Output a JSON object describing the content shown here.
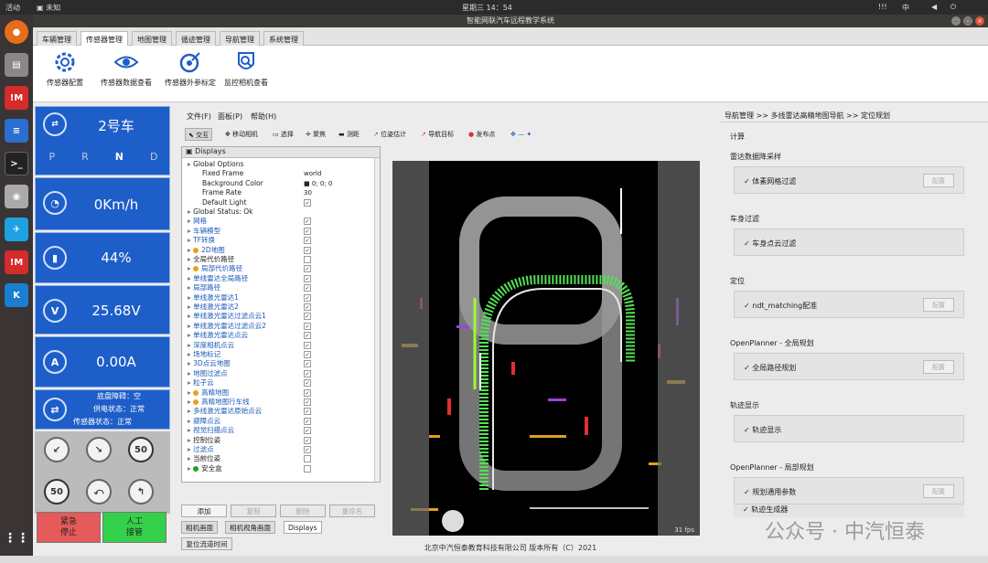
{
  "topbar": {
    "activities": "活动",
    "app": "未知",
    "clock": "星期三 14：54",
    "ime": "中",
    "net": "!!!"
  },
  "window": {
    "title": "智能网联汽车远程教学系统"
  },
  "menu_tabs": [
    "车辆管理",
    "传感器管理",
    "地图管理",
    "循迹管理",
    "导航管理",
    "系统管理"
  ],
  "ribbon": [
    {
      "label": "传感器配置",
      "icon": "gear-icon"
    },
    {
      "label": "传感器数据查看",
      "icon": "eye-icon"
    },
    {
      "label": "传感器外参标定",
      "icon": "calibrate-icon"
    },
    {
      "label": "监控相机查看",
      "icon": "camera-search-icon"
    }
  ],
  "left": {
    "car": "2号车",
    "gears": [
      "P",
      "R",
      "N",
      "D"
    ],
    "speed": "0Km/h",
    "battery": "44%",
    "voltage": "25.68V",
    "current": "0.00A",
    "circle_labels": [
      "V",
      "A"
    ],
    "status": [
      "底盘障碍：空",
      "供电状态：正常",
      "传感器状态：正常"
    ],
    "signs": [
      "50",
      "50"
    ],
    "estop": "紧急\n停止",
    "takeover": "人工\n接管"
  },
  "center": {
    "menus": [
      "文件(F)",
      "面板(P)",
      "帮助(H)"
    ],
    "tools": [
      "交互",
      "移动相机",
      "选择",
      "聚焦",
      "测距",
      "位姿估计",
      "导航目标",
      "发布点"
    ],
    "panel_title": "Displays",
    "displays": [
      {
        "label": "Global Options",
        "indent": 1,
        "value": ""
      },
      {
        "label": "Fixed Frame",
        "indent": 2,
        "value": "world"
      },
      {
        "label": "Background Color",
        "indent": 2,
        "value": "■ 0; 0; 0"
      },
      {
        "label": "Frame Rate",
        "indent": 2,
        "value": "30"
      },
      {
        "label": "Default Light",
        "indent": 2,
        "value": "✓"
      },
      {
        "label": "Global Status: Ok",
        "indent": 1,
        "value": ""
      },
      {
        "label": "网格",
        "indent": 1,
        "value": "✓",
        "blue": true
      },
      {
        "label": "车辆模型",
        "indent": 1,
        "value": "✓",
        "blue": true
      },
      {
        "label": "TF转换",
        "indent": 1,
        "value": "✓",
        "blue": true
      },
      {
        "label": "2D地图",
        "indent": 1,
        "value": "✓",
        "blue": true,
        "color": "#e8a020"
      },
      {
        "label": "全局代价路径",
        "indent": 1,
        "value": "",
        "blue": false
      },
      {
        "label": "局部代价路径",
        "indent": 1,
        "value": "✓",
        "blue": true,
        "color": "#e8a020"
      },
      {
        "label": "单线雷达全局路径",
        "indent": 1,
        "value": "✓",
        "blue": true
      },
      {
        "label": "局部路径",
        "indent": 1,
        "value": "✓",
        "blue": true
      },
      {
        "label": "单线激光雷达1",
        "indent": 1,
        "value": "✓",
        "blue": true
      },
      {
        "label": "单线激光雷达2",
        "indent": 1,
        "value": "✓",
        "blue": true
      },
      {
        "label": "单线激光雷达过滤点云1",
        "indent": 1,
        "value": "✓",
        "blue": true
      },
      {
        "label": "单线激光雷达过滤点云2",
        "indent": 1,
        "value": "✓",
        "blue": true
      },
      {
        "label": "单线激光雷达点云",
        "indent": 1,
        "value": "✓",
        "blue": true
      },
      {
        "label": "深度相机点云",
        "indent": 1,
        "value": "✓",
        "blue": true
      },
      {
        "label": "场地标记",
        "indent": 1,
        "value": "✓",
        "blue": true
      },
      {
        "label": "3D点云地图",
        "indent": 1,
        "value": "✓",
        "blue": true
      },
      {
        "label": "地图过滤点",
        "indent": 1,
        "value": "✓",
        "blue": true
      },
      {
        "label": "粒子云",
        "indent": 1,
        "value": "✓",
        "blue": true
      },
      {
        "label": "高精地图",
        "indent": 1,
        "value": "✓",
        "blue": true,
        "color": "#e8a020"
      },
      {
        "label": "高精地图行车线",
        "indent": 1,
        "value": "✓",
        "blue": true,
        "color": "#e8a020"
      },
      {
        "label": "多线激光雷达原始点云",
        "indent": 1,
        "value": "✓",
        "blue": true
      },
      {
        "label": "避障点云",
        "indent": 1,
        "value": "✓",
        "blue": true
      },
      {
        "label": "视觉扫描点云",
        "indent": 1,
        "value": "✓",
        "blue": true
      },
      {
        "label": "控制位姿",
        "indent": 1,
        "value": "✓",
        "blue": false
      },
      {
        "label": "过滤点",
        "indent": 1,
        "value": "✓",
        "blue": true
      },
      {
        "label": "当前位姿",
        "indent": 1,
        "value": "",
        "blue": false
      },
      {
        "label": "安全盒",
        "indent": 1,
        "value": "",
        "blue": false,
        "color": "#20a020"
      }
    ],
    "buttons": [
      "添加",
      "复制",
      "删除",
      "重命名"
    ],
    "bottom_tabs": [
      "相机画面",
      "相机视角画面",
      "Displays"
    ],
    "reset": "复位流道时间",
    "fps": "31 fps"
  },
  "right": {
    "breadcrumb": "导航管理 >> 多线雷达高精地图导航 >> 定位规划",
    "calc": "计算",
    "sections": [
      {
        "title": "雷达数据降采样",
        "check": "体素网格过滤",
        "cfg": "配置"
      },
      {
        "title": "车身过滤",
        "check": "车身点云过滤",
        "cfg": ""
      },
      {
        "title": "定位",
        "check": "ndt_matching配准",
        "cfg": "配置"
      },
      {
        "title": "OpenPlanner - 全局规划",
        "check": "全局路径规划",
        "cfg": "配置"
      },
      {
        "title": "轨迹显示",
        "check": "轨迹显示",
        "cfg": ""
      },
      {
        "title": "OpenPlanner - 局部规划",
        "check": "规划通用参数",
        "cfg": "配置"
      }
    ],
    "extra": "轨迹生成器"
  },
  "footer": "北京中汽恒泰教育科技有限公司 版本所有（C）2021",
  "watermark": "公众号 · 中汽恒泰",
  "colors": {
    "panel_blue": "#1e5ec8",
    "estop": "#e55a5a",
    "takeover": "#35d04a"
  }
}
